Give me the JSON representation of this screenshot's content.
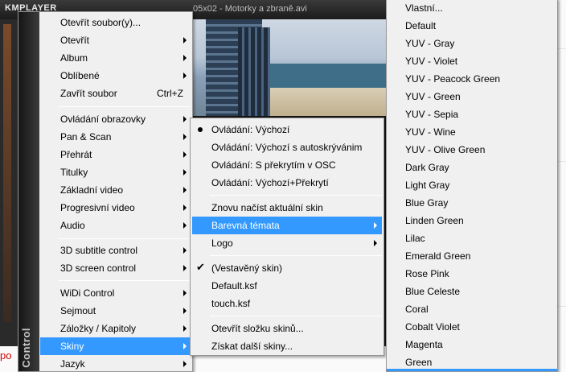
{
  "player": {
    "logo": "KMPLAYER",
    "title": "05x02 - Motorky a zbraně.avi",
    "side_label": "Control",
    "background_fragment": "po"
  },
  "main_menu": {
    "items": [
      {
        "label": "Otevřít soubor(y)...",
        "submenu": false
      },
      {
        "label": "Otevřít",
        "submenu": true
      },
      {
        "label": "Album",
        "submenu": true
      },
      {
        "label": "Oblíbené",
        "submenu": true
      },
      {
        "label": "Zavřít soubor",
        "shortcut": "Ctrl+Z",
        "submenu": false
      },
      {
        "label": "Ovládání obrazovky",
        "submenu": true
      },
      {
        "label": "Pan & Scan",
        "submenu": true
      },
      {
        "label": "Přehrát",
        "submenu": true
      },
      {
        "label": "Titulky",
        "submenu": true
      },
      {
        "label": "Základní video",
        "submenu": true
      },
      {
        "label": "Progresivní video",
        "submenu": true
      },
      {
        "label": "Audio",
        "submenu": true
      },
      {
        "label": "3D subtitle control",
        "submenu": true
      },
      {
        "label": "3D screen control",
        "submenu": true
      },
      {
        "label": "WiDi Control",
        "submenu": true
      },
      {
        "label": "Sejmout",
        "submenu": true
      },
      {
        "label": "Záložky / Kapitoly",
        "submenu": true
      },
      {
        "label": "Skiny",
        "submenu": true,
        "highlighted": true
      },
      {
        "label": "Jazyk",
        "submenu": true
      }
    ]
  },
  "skins_menu": {
    "items": [
      {
        "label": "Ovládání: Výchozí",
        "mark": "bullet"
      },
      {
        "label": "Ovládání: Výchozí s autoskrývánim"
      },
      {
        "label": "Ovládání: S překrytím v OSC"
      },
      {
        "label": "Ovládání: Výchozí+Překrytí"
      },
      {
        "label": "Znovu načíst aktuální skin"
      },
      {
        "label": "Barevná témata",
        "submenu": true,
        "highlighted": true
      },
      {
        "label": "Logo",
        "submenu": true
      },
      {
        "label": "(Vestavěný skin)",
        "mark": "check"
      },
      {
        "label": "Default.ksf"
      },
      {
        "label": "touch.ksf"
      },
      {
        "label": "Otevřít složku skinů..."
      },
      {
        "label": "Získat další skiny..."
      }
    ]
  },
  "color_themes_menu": {
    "items": [
      "Vlastní...",
      "Default",
      "YUV - Gray",
      "YUV - Violet",
      "YUV - Peacock Green",
      "YUV - Green",
      "YUV - Sepia",
      "YUV - Wine",
      "YUV - Olive Green",
      "Dark Gray",
      "Light Gray",
      "Blue Gray",
      "Linden Green",
      "Lilac",
      "Emerald Green",
      "Rose Pink",
      "Blue Celeste",
      "Coral",
      "Cobalt Violet",
      "Magenta",
      "Green"
    ]
  },
  "colors": {
    "highlight": "#3399ff",
    "menu_bg": "#f0f0f0",
    "menu_border": "#979797"
  }
}
